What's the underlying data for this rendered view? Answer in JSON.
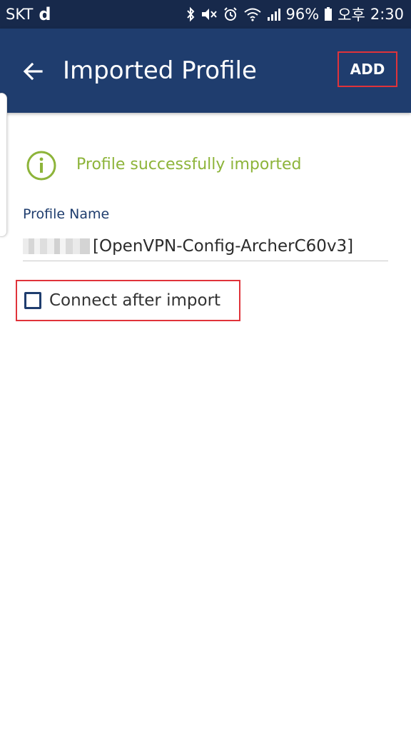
{
  "status_bar": {
    "carrier": "SKT",
    "carrier_badge": "d",
    "battery": "96%",
    "ampm": "오후",
    "time": "2:30"
  },
  "app_bar": {
    "title": "Imported Profile",
    "add_label": "ADD"
  },
  "success": {
    "message": "Profile successfully imported"
  },
  "profile_name": {
    "label": "Profile Name",
    "value": "[OpenVPN-Config-ArcherC60v3]"
  },
  "connect_after_import": {
    "label": "Connect after import",
    "checked": false
  },
  "colors": {
    "status_bar": "#17294b",
    "app_bar": "#1f3d6e",
    "success": "#8db43a",
    "highlight": "#e0333a"
  }
}
